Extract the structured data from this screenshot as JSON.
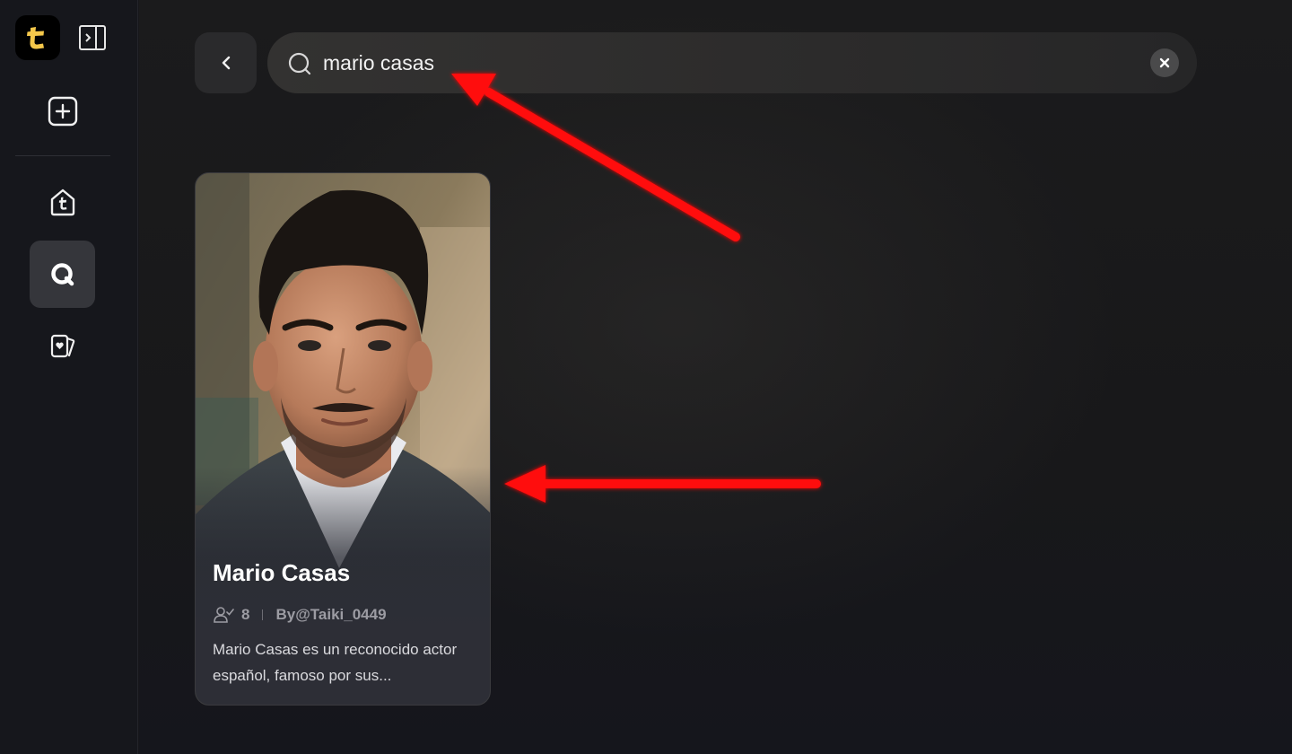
{
  "sidebar": {
    "logo_letter": "t",
    "items": [
      {
        "name": "collapse-sidebar",
        "icon": "sidebar-toggle-icon"
      },
      {
        "name": "create-new",
        "icon": "plus-square-icon"
      },
      {
        "name": "home",
        "icon": "home-icon"
      },
      {
        "name": "search",
        "icon": "search-icon",
        "active": true
      },
      {
        "name": "cards",
        "icon": "cards-icon"
      }
    ]
  },
  "search": {
    "value": "mario casas",
    "placeholder": ""
  },
  "results": [
    {
      "title": "Mario Casas",
      "followers": "8",
      "author": "By@Taiki_0449",
      "description": "Mario Casas es un reconocido actor español, famoso por sus..."
    }
  ],
  "colors": {
    "background": "#17171a",
    "sidebar": "#16171c",
    "logo_accent": "#f5c84b",
    "annotation_arrow": "#ff0a0a"
  }
}
